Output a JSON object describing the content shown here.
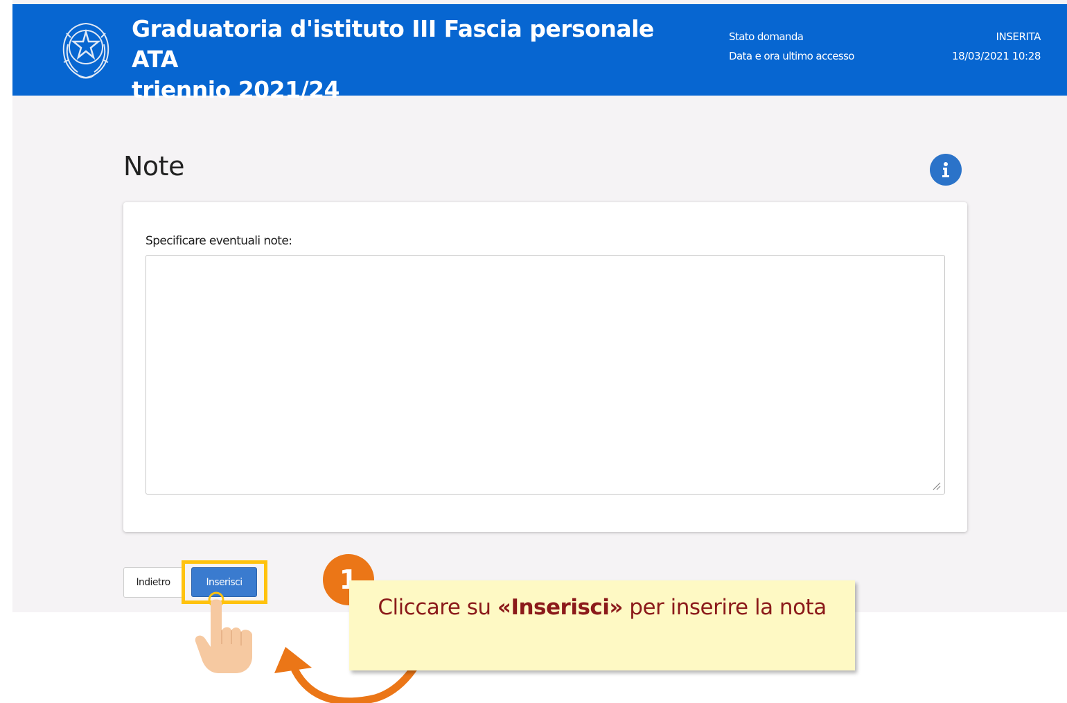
{
  "header": {
    "title": "Graduatoria d'istituto III Fascia personale ATA\ntriennio 2021/24",
    "emblem_icon": "italian-republic-emblem-icon",
    "status_label": "Stato domanda",
    "status_value": "INSERITA",
    "last_access_label": "Data e ora ultimo accesso",
    "last_access_value": "18/03/2021 10:28",
    "background_color": "#0766d1"
  },
  "main": {
    "section_title": "Note",
    "info_icon": "info-icon",
    "notes_label": "Specificare eventuali note:",
    "notes_value": ""
  },
  "actions": {
    "back_label": "Indietro",
    "insert_label": "Inserisci"
  },
  "tutorial": {
    "step_number": "1",
    "callout_prefix": "Cliccare su ",
    "callout_emphasis": "«Inserisci»",
    "callout_suffix": " per inserire la nota",
    "highlight_color": "#ffc20e",
    "badge_color": "#eb7617",
    "callout_color": "#fef9c4"
  }
}
